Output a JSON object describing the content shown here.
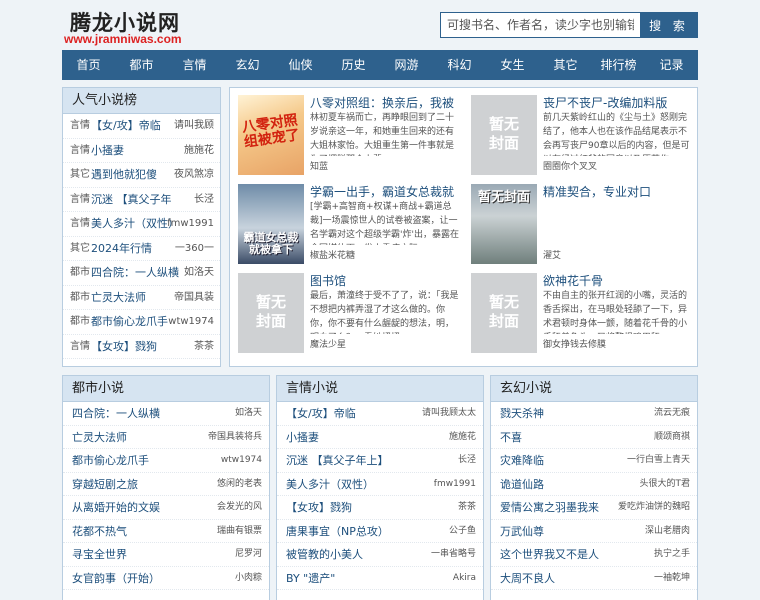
{
  "site": {
    "name": "腾龙小说网",
    "domain": "www.jramniwas.com"
  },
  "search": {
    "placeholder": "可搜书名、作者名，读少字也别输错字",
    "button_label": "搜 索"
  },
  "nav": [
    "首页",
    "都市",
    "言情",
    "玄幻",
    "仙侠",
    "历史",
    "网游",
    "科幻",
    "女生",
    "其它",
    "排行榜",
    "记录"
  ],
  "popular": {
    "title": "人气小说榜",
    "rows": [
      {
        "cat": "言情",
        "title": "【女/攻】帝临",
        "author": "请叫我顾"
      },
      {
        "cat": "言情",
        "title": "小搔妻",
        "author": "施施花"
      },
      {
        "cat": "其它",
        "title": "遇到他就犯傻",
        "author": "夜风煞凉"
      },
      {
        "cat": "言情",
        "title": "沉迷 【真父子年",
        "author": "长泾"
      },
      {
        "cat": "言情",
        "title": "美人多汁（双性）",
        "author": "fmw1991"
      },
      {
        "cat": "其它",
        "title": "2024年行情",
        "author": "一360一"
      },
      {
        "cat": "都市",
        "title": "四合院：一人纵横",
        "author": "如洛天"
      },
      {
        "cat": "都市",
        "title": "亡灵大法师",
        "author": "帝国具装"
      },
      {
        "cat": "都市",
        "title": "都市偷心龙爪手",
        "author": "wtw1974"
      },
      {
        "cat": "言情",
        "title": "【女攻】戮狗",
        "author": "茶茶"
      }
    ]
  },
  "featured": [
    {
      "title": "八零对照组：换亲后，我被",
      "desc": "林初夏车祸而亡，再睁眼回到了二十岁说亲这一年，和她重生回来的还有大姐林家怡。大姐重生第一件事就是为了摆脱那个上辈",
      "author": "知蓝",
      "cover_text": "八零对照组被宠了"
    },
    {
      "title": "丧尸不丧尸-改编加料版",
      "desc": "前几天紫岭红山的《尘与土》怒刚完结了，他本人也在该作品结尾表示不会再写丧尸90章以后的内容，但是可以在经过红爷的同意以及原著作",
      "author": "圈圈你个叉叉",
      "cover_text": "暂无封面"
    },
    {
      "title": "学霸一出手，霸道女总裁就",
      "desc": "[学霸+高智商+权谋+商战+霸道总裁]一场震惊世人的试卷被盗案，让一名学霸对这个超级学霸'炸'出，暴露在全国媒体下。发小重病之际，",
      "author": "椒盐米花糖",
      "cover_text": "霸道女总裁就被拿下"
    },
    {
      "title": "精准契合，专业对口",
      "desc": "",
      "author": "濯艾",
      "cover_text": "暂无封面"
    },
    {
      "title": "图书馆",
      "desc": "最后，萧潼终于受不了了，说：「我是不想把内裤弄湿了才这么做的。你你，你不要有什么龌龊的想法，明，明白了么？」看她扭扭",
      "author": "魔法少星",
      "cover_text": "暂无封面"
    },
    {
      "title": "欲神花千骨",
      "desc": "不由自主的张开红润的小嘴，灵活的香舌探出，在马眼处轻舔了一下，异术君顿时身体一颤，随着花千骨的小舌舔着龟头，又将整根鸡巴舔",
      "author": "御女挣钱去修膜",
      "cover_text": "暂无封面"
    }
  ],
  "dushi": {
    "title": "都市小说",
    "rows": [
      {
        "title": "四合院：一人纵横",
        "author": "如洛天"
      },
      {
        "title": "亡灵大法师",
        "author": "帝国具装将兵"
      },
      {
        "title": "都市偷心龙爪手",
        "author": "wtw1974"
      },
      {
        "title": "穿越短剧之旅",
        "author": "悠闲的老表"
      },
      {
        "title": "从离婚开始的文娱",
        "author": "会发光的风"
      },
      {
        "title": "花都不热气",
        "author": "瑞曲有银票"
      },
      {
        "title": "寻宝全世界",
        "author": "尼罗河"
      },
      {
        "title": "女官韵事（开始）",
        "author": "小肉粽"
      }
    ]
  },
  "yanqing": {
    "title": "言情小说",
    "rows": [
      {
        "title": "【女/攻】帝临",
        "author": "请叫我顾太太"
      },
      {
        "title": "小搔妻",
        "author": "施施花"
      },
      {
        "title": "沉迷 【真父子年上】",
        "author": "长泾"
      },
      {
        "title": "美人多汁（双性）",
        "author": "fmw1991"
      },
      {
        "title": "【女攻】戮狗",
        "author": "茶茶"
      },
      {
        "title": "唐果事宜（NP总攻）",
        "author": "公子鱼"
      },
      {
        "title": "被管教的小美人",
        "author": "一串省略号"
      },
      {
        "title": "BY \"遗产\"",
        "author": "Akira"
      }
    ]
  },
  "xuanhuan": {
    "title": "玄幻小说",
    "rows": [
      {
        "title": "戮天杀神",
        "author": "流云无痕"
      },
      {
        "title": "不喜",
        "author": "顺颂商祺"
      },
      {
        "title": "灾难降临",
        "author": "一行白雪上青天"
      },
      {
        "title": "诡道仙路",
        "author": "头很大的T君"
      },
      {
        "title": "爱情公寓之羽墨我来",
        "author": "爱吃炸油饼的魏昭"
      },
      {
        "title": "万武仙尊",
        "author": "深山老腊肉"
      },
      {
        "title": "这个世界我又不是人",
        "author": "执宁之手"
      },
      {
        "title": "大周不良人",
        "author": "一袖乾坤"
      }
    ]
  }
}
